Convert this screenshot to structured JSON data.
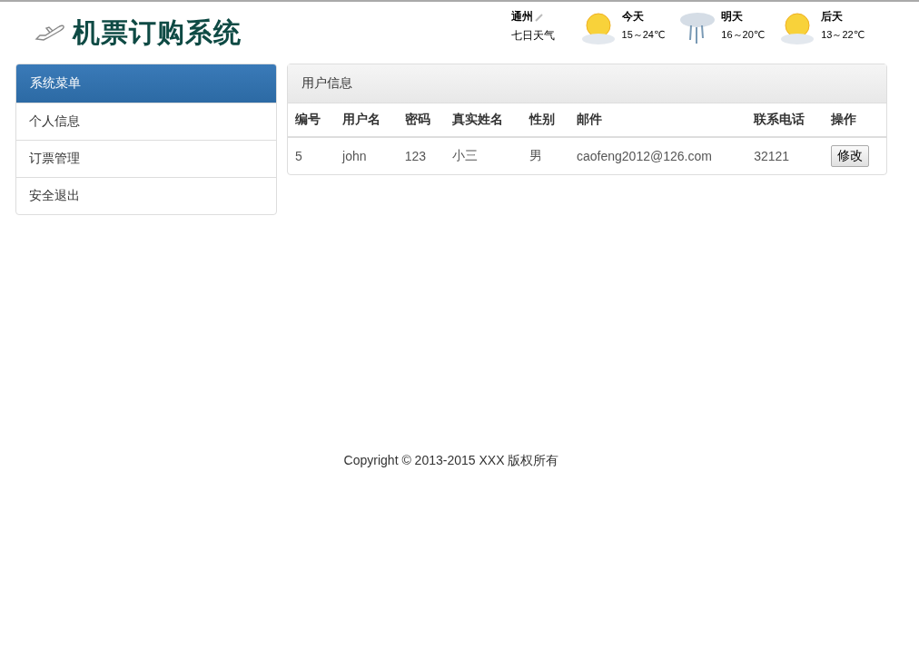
{
  "header": {
    "title": "机票订购系统"
  },
  "weather": {
    "city": "通州",
    "link": "七日天气",
    "days": [
      {
        "label": "今天",
        "temp": "15～24℃",
        "kind": "sun"
      },
      {
        "label": "明天",
        "temp": "16～20℃",
        "kind": "rain"
      },
      {
        "label": "后天",
        "temp": "13～22℃",
        "kind": "sun"
      }
    ]
  },
  "sidebar": {
    "title": "系统菜单",
    "items": [
      {
        "label": "个人信息"
      },
      {
        "label": "订票管理"
      },
      {
        "label": "安全退出"
      }
    ]
  },
  "panel": {
    "title": "用户信息",
    "columns": [
      "编号",
      "用户名",
      "密码",
      "真实姓名",
      "性别",
      "邮件",
      "联系电话",
      "操作"
    ],
    "rows": [
      {
        "cells": [
          "5",
          "john",
          "123",
          "小三",
          "男",
          "caofeng2012@126.com",
          "32121"
        ],
        "action": "修改"
      }
    ]
  },
  "footer": "Copyright © 2013-2015 XXX 版权所有"
}
